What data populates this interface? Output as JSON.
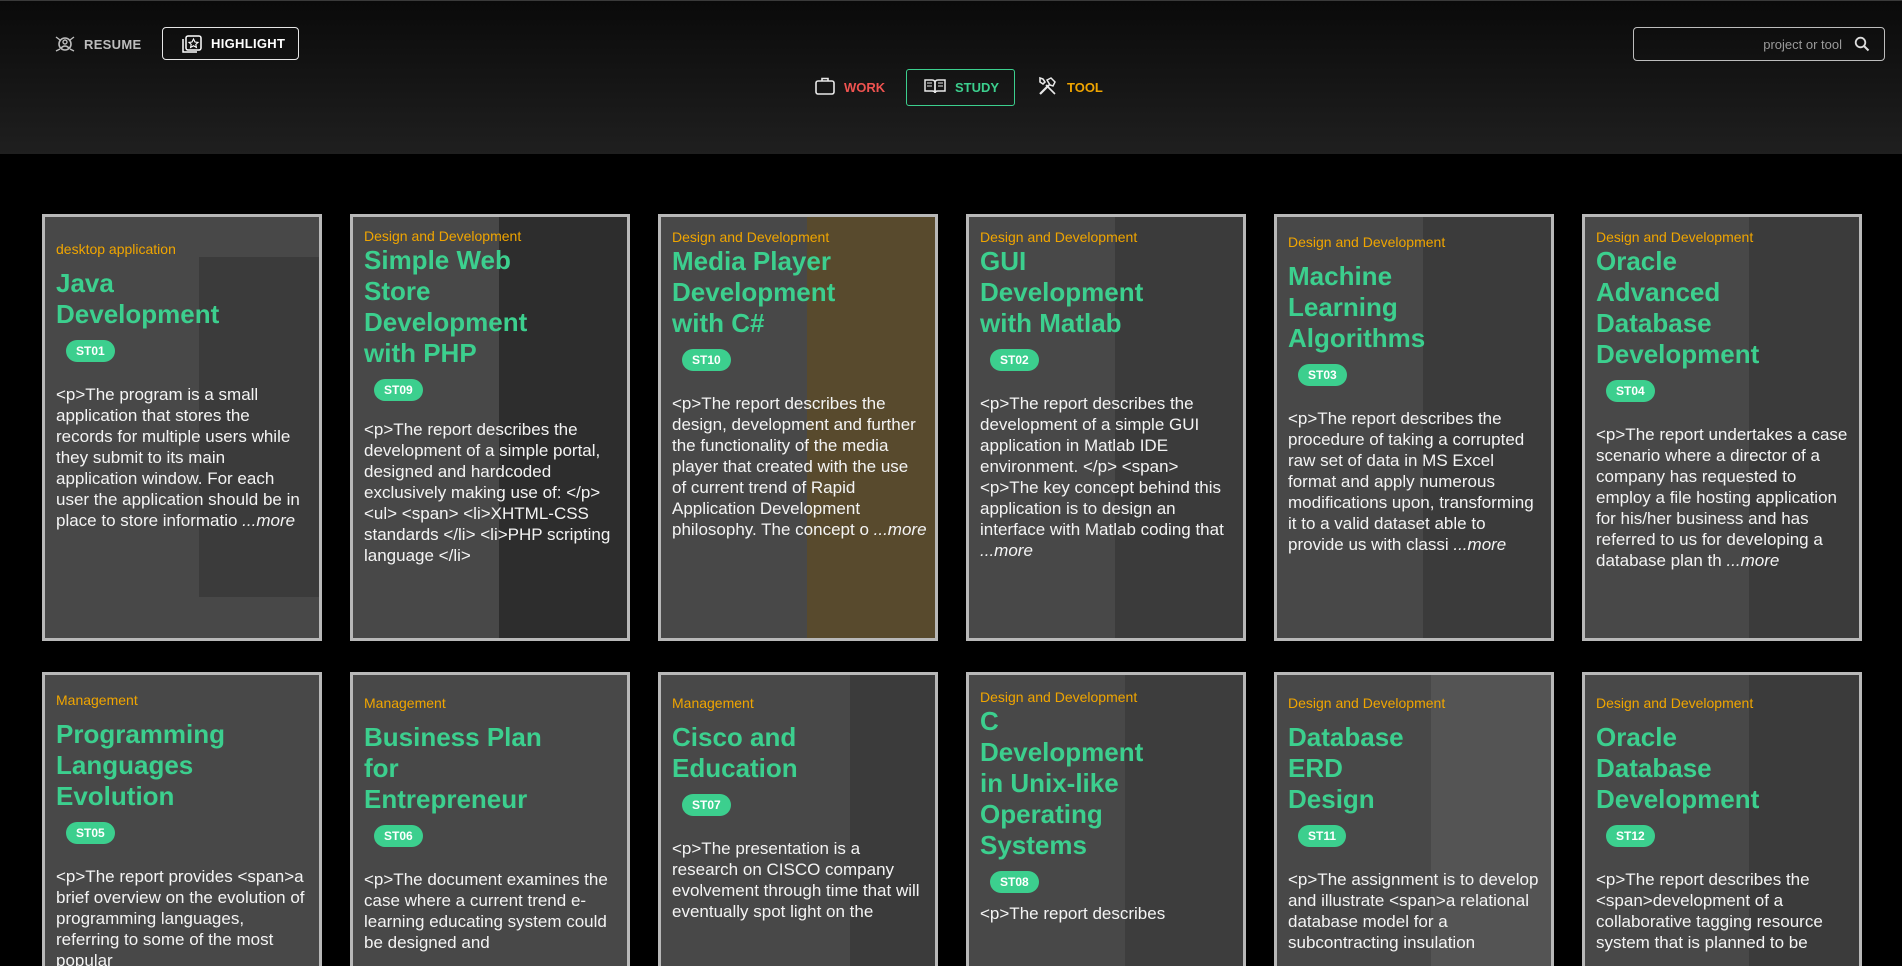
{
  "header": {
    "resume_label": "RESUME",
    "highlight_label": "HIGHLIGHT",
    "search_placeholder": "project or tool"
  },
  "nav": {
    "work": "WORK",
    "study": "STUDY",
    "tool": "TOOL"
  },
  "colors": {
    "work": "#ef5350",
    "study": "#3ccf8e",
    "tool": "#f0a500",
    "card_bg": "#484848"
  },
  "cards": [
    {
      "category": "desktop application",
      "title": "Java Development",
      "code": "ST01",
      "desc": "<p>The program is a small application that stores the records for multiple users while they submit to its main application window. For each user the application should be in place to store informatio",
      "more": "...more"
    },
    {
      "category": "Design and Development",
      "title": "Simple Web Store Development with PHP",
      "code": "ST09",
      "desc": "<p>The report describes the development of a simple portal, designed and hardcoded exclusively making use of: </p> <ul> <span> <li>XHTML-CSS standards </li> <li>PHP scripting language </li>",
      "more": ""
    },
    {
      "category": "Design and Development",
      "title": "Media Player Development with C#",
      "code": "ST10",
      "desc": "<p>The report describes the design, development and further the functionality of the media player that created with the use of current trend of Rapid Application Development philosophy. The concept o",
      "more": "...more"
    },
    {
      "category": "Design and Development",
      "title": "GUI Development with Matlab",
      "code": "ST02",
      "desc": "<p>The report describes the development of a simple GUI application in Matlab IDE environment. </p> <span><p>The key concept behind this application is to design an interface with Matlab coding that",
      "more": "...more"
    },
    {
      "category": "Design and Development",
      "title": "Machine Learning Algorithms",
      "code": "ST03",
      "desc": "<p>The report describes the procedure of taking a corrupted raw set of data in MS Excel format and apply numerous modifications upon, transforming it to a valid dataset able to provide us with classi",
      "more": "...more"
    },
    {
      "category": "Design and Development",
      "title": "Oracle Advanced Database Development",
      "code": "ST04",
      "desc": "<p>The report undertakes a case scenario where a director of a company has requested to employ a file hosting application for his/her business and has referred to us for developing a database plan th",
      "more": "...more"
    },
    {
      "category": "Management",
      "title": "Programming Languages Evolution",
      "code": "ST05",
      "desc": "<p>The report provides <span>a brief overview on the evolution of programming languages, referring to some of the most popular",
      "more": ""
    },
    {
      "category": "Management",
      "title": "Business Plan for Entrepreneur",
      "code": "ST06",
      "desc": "<p>The document examines the case where a current trend e-learning educating system could be designed and",
      "more": ""
    },
    {
      "category": "Management",
      "title": "Cisco and Education",
      "code": "ST07",
      "desc": "<p>The presentation is a research on CISCO company evolvement through time that will eventually spot light on the",
      "more": ""
    },
    {
      "category": "Design and Development",
      "title": "C Development in Unix-like Operating Systems",
      "code": "ST08",
      "desc": "<p>The report describes",
      "more": ""
    },
    {
      "category": "Design and Development",
      "title": "Database ERD Design",
      "code": "ST11",
      "desc": "<p>The assignment is to develop and illustrate <span>a relational database model for a subcontracting insulation",
      "more": ""
    },
    {
      "category": "Design and Development",
      "title": "Oracle Database Development",
      "code": "ST12",
      "desc": "<p>The report describes the <span>development of a collaborative tagging resource system that is planned to be",
      "more": ""
    }
  ]
}
